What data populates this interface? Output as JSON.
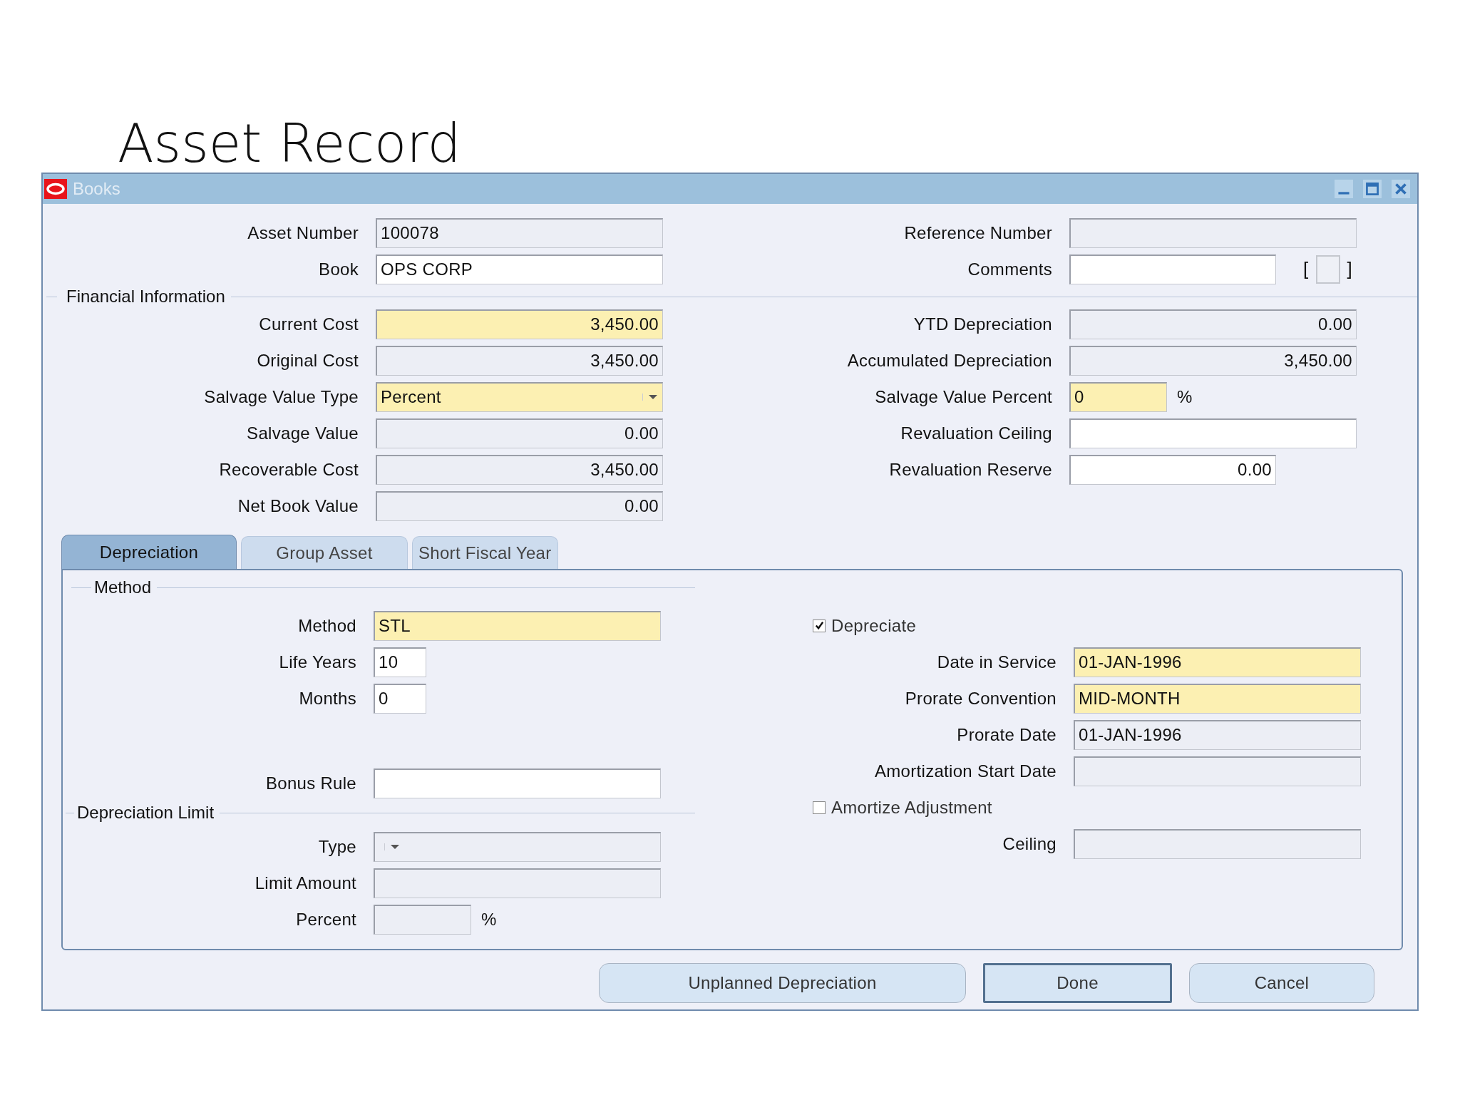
{
  "slide_title": "Asset Record",
  "window": {
    "title": "Books"
  },
  "general": {
    "left": [
      {
        "label": "Asset Number",
        "value": "100078",
        "kind": "readonly"
      },
      {
        "label": "Book",
        "value": "OPS CORP",
        "kind": "editable"
      }
    ],
    "right": [
      {
        "label": "Reference Number",
        "kind": "readonly"
      },
      {
        "label": "Comments",
        "kind": "editable_medium",
        "brackets": [
          "[",
          "]"
        ]
      }
    ]
  },
  "financial_information": {
    "title": "Financial Information",
    "left": [
      {
        "label": "Current Cost",
        "value": "3,450.00",
        "kind": "required",
        "numeric": true
      },
      {
        "label": "Original Cost",
        "value": "3,450.00",
        "kind": "readonly",
        "numeric": true
      },
      {
        "label": "Salvage Value Type",
        "value": "Percent",
        "kind": "required",
        "dropdown": true
      },
      {
        "label": "Salvage Value",
        "value": "0.00",
        "kind": "readonly",
        "numeric": true
      },
      {
        "label": "Recoverable Cost",
        "value": "3,450.00",
        "kind": "readonly",
        "numeric": true
      },
      {
        "label": "Net Book Value",
        "value": "0.00",
        "kind": "readonly",
        "numeric": true
      }
    ],
    "right": [
      {
        "label": "YTD Depreciation",
        "value": "0.00",
        "kind": "readonly",
        "numeric": true
      },
      {
        "label": "Accumulated Depreciation",
        "value": "3,450.00",
        "kind": "readonly",
        "numeric": true
      },
      {
        "label": "Salvage Value Percent",
        "value": "0",
        "kind": "required_small",
        "suffix": "%"
      },
      {
        "label": "Revaluation Ceiling",
        "kind": "editable"
      },
      {
        "label": "Revaluation Reserve",
        "value": "0.00",
        "kind": "editable_medium",
        "numeric": true
      }
    ]
  },
  "tabs": [
    {
      "label": "Depreciation",
      "selected": true
    },
    {
      "label": "Group Asset",
      "selected": false
    },
    {
      "label": "Short Fiscal Year",
      "selected": false
    }
  ],
  "method_section": {
    "title": "Method",
    "fields": [
      {
        "label": "Method",
        "value": "STL",
        "kind": "required"
      },
      {
        "label": "Life Years",
        "value": "10",
        "kind": "editable_short"
      },
      {
        "label": "Months",
        "value": "0",
        "kind": "editable_short"
      }
    ]
  },
  "bonus_rule": {
    "label": "Bonus Rule",
    "kind": "editable"
  },
  "limit_section": {
    "title": "Depreciation Limit",
    "fields": [
      {
        "label": "Type",
        "kind": "readonly",
        "dropdown": true
      },
      {
        "label": "Limit Amount",
        "kind": "readonly"
      },
      {
        "label": "Percent",
        "kind": "readonly_small",
        "suffix": "%"
      }
    ]
  },
  "depreciation_right": [
    {
      "kind": "checkbox",
      "label": "Depreciate",
      "checked": true
    },
    {
      "label": "Date in Service",
      "value": "01-JAN-1996",
      "kind": "required"
    },
    {
      "label": "Prorate Convention",
      "value": "MID-MONTH",
      "kind": "required"
    },
    {
      "label": "Prorate Date",
      "value": "01-JAN-1996",
      "kind": "readonly"
    },
    {
      "label": "Amortization Start Date",
      "kind": "readonly"
    },
    {
      "kind": "checkbox",
      "label": "Amortize Adjustment",
      "checked": false
    },
    {
      "label": "Ceiling",
      "kind": "readonly"
    }
  ],
  "buttons": [
    {
      "label": "Unplanned Depreciation",
      "default": false
    },
    {
      "label": "Done",
      "default": true
    },
    {
      "label": "Cancel",
      "default": false
    }
  ]
}
